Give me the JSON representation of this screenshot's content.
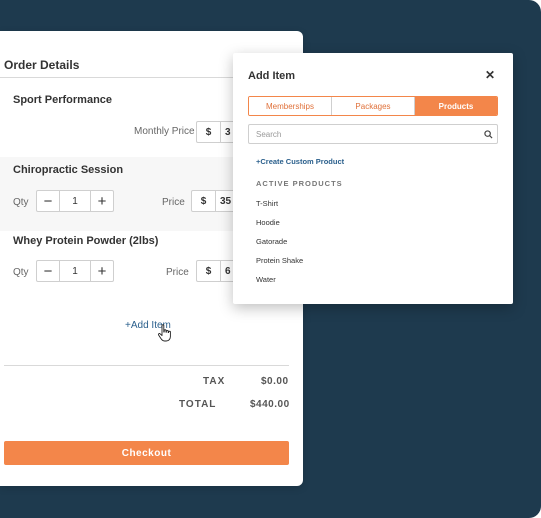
{
  "order": {
    "title": "Order Details",
    "items": [
      {
        "name": "Sport Performance",
        "price_label": "Monthly Price",
        "currency": "$",
        "amount": "3"
      },
      {
        "name": "Chiropractic Session",
        "qty_label": "Qty",
        "qty": "1",
        "price_label": "Price",
        "currency": "$",
        "amount": "35"
      },
      {
        "name": "Whey Protein Powder (2lbs)",
        "qty_label": "Qty",
        "qty": "1",
        "price_label": "Price",
        "currency": "$",
        "amount": "6"
      }
    ],
    "add_item_label": "+Add Item",
    "tax_label": "TAX",
    "tax_value": "$0.00",
    "total_label": "TOTAL",
    "total_value": "$440.00",
    "checkout_label": "Checkout"
  },
  "modal": {
    "title": "Add Item",
    "close": "✕",
    "tabs": [
      {
        "label": "Memberships",
        "active": false
      },
      {
        "label": "Packages",
        "active": false
      },
      {
        "label": "Products",
        "active": true
      }
    ],
    "search_placeholder": "Search",
    "create_link": "+Create Custom Product",
    "section_heading": "ACTIVE PRODUCTS",
    "products": [
      "T-Shirt",
      "Hoodie",
      "Gatorade",
      "Protein Shake",
      "Water"
    ]
  },
  "colors": {
    "background": "#1e3a4e",
    "accent": "#f3864a",
    "link": "#2a5f8c"
  }
}
